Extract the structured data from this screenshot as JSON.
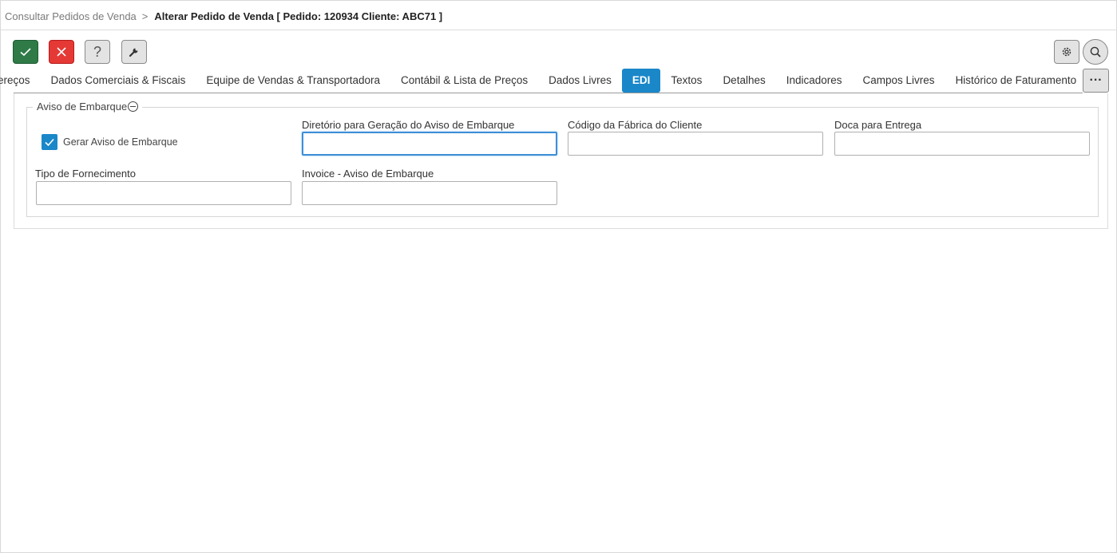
{
  "breadcrumb": {
    "parent": "Consultar Pedidos de Venda",
    "separator": ">",
    "current": "Alterar Pedido de Venda [ Pedido: 120934 Cliente: ABC71 ]"
  },
  "toolbar": {
    "help_label": "?"
  },
  "tabs": [
    {
      "label": "Endereços"
    },
    {
      "label": "Dados Comerciais & Fiscais"
    },
    {
      "label": "Equipe de Vendas & Transportadora"
    },
    {
      "label": "Contábil & Lista de Preços"
    },
    {
      "label": "Dados Livres"
    },
    {
      "label": "EDI",
      "active": true
    },
    {
      "label": "Textos"
    },
    {
      "label": "Detalhes"
    },
    {
      "label": "Indicadores"
    },
    {
      "label": "Campos Livres"
    },
    {
      "label": "Histórico de Faturamento"
    }
  ],
  "tabs_more_label": "···",
  "section": {
    "title": "Aviso de Embarque",
    "checkbox": {
      "label": "Gerar Aviso de Embarque",
      "checked": true
    },
    "fields": {
      "diretorio": {
        "label": "Diretório para Geração do Aviso de Embarque",
        "value": ""
      },
      "codigo_fabrica": {
        "label": "Código da Fábrica do Cliente",
        "value": ""
      },
      "doca": {
        "label": "Doca para Entrega",
        "value": ""
      },
      "tipo_fornecimento": {
        "label": "Tipo de Fornecimento",
        "value": ""
      },
      "invoice": {
        "label": "Invoice - Aviso de Embarque",
        "value": ""
      }
    }
  },
  "colors": {
    "accent": "#1a87c9",
    "ok_button": "#2f7a46",
    "cancel_button": "#e53935"
  }
}
